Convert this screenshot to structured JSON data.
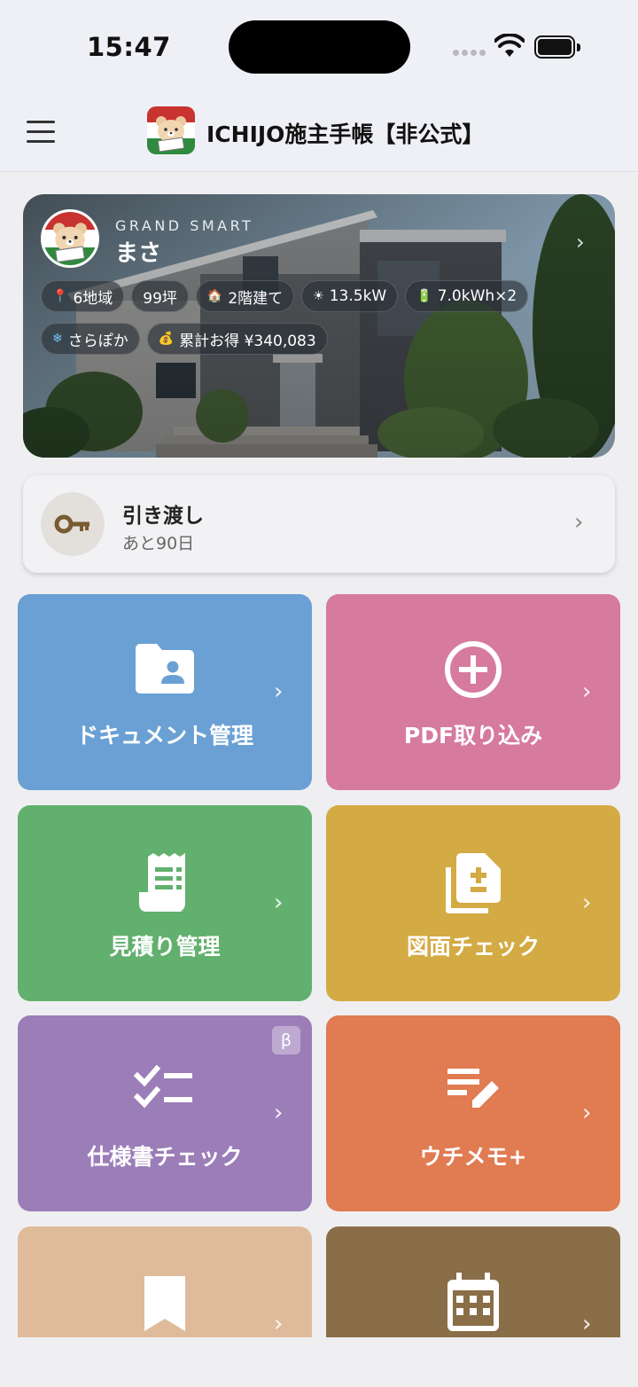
{
  "status_bar": {
    "time": "15:47"
  },
  "header": {
    "title": "ICHIJO施主手帳【非公式】"
  },
  "hero": {
    "model": "GRAND SMART",
    "owner": "まさ",
    "chips_row1": [
      {
        "icon": "📍",
        "label": "6地域"
      },
      {
        "icon": "",
        "label": "99坪"
      },
      {
        "icon": "🏠",
        "label": "2階建て"
      },
      {
        "icon": "☀",
        "label": "13.5kW"
      },
      {
        "icon": "🔋",
        "label": "7.0kWh×2"
      }
    ],
    "chips_row2": [
      {
        "icon": "❄",
        "label": "さらぽか"
      },
      {
        "icon": "💰",
        "label": "累計お得 ¥340,083"
      }
    ]
  },
  "handover": {
    "title": "引き渡し",
    "subtitle": "あと90日"
  },
  "tiles": [
    {
      "label": "ドキュメント管理",
      "color": "#6aa0d4",
      "icon": "folder-person-icon"
    },
    {
      "label": "PDF取り込み",
      "color": "#d67a9e",
      "icon": "add-circle-icon"
    },
    {
      "label": "見積り管理",
      "color": "#62b06e",
      "icon": "receipt-icon"
    },
    {
      "label": "図面チェック",
      "color": "#d4aa44",
      "icon": "document-add-icon"
    },
    {
      "label": "仕様書チェック",
      "color": "#9b7db8",
      "icon": "checklist-icon",
      "badge": "β"
    },
    {
      "label": "ウチメモ+",
      "color": "#e07b52",
      "icon": "note-edit-icon"
    },
    {
      "label": "",
      "color": "#dfbb9b",
      "icon": "bookmark-icon"
    },
    {
      "label": "",
      "color": "#8a6e47",
      "icon": "calendar-icon"
    }
  ]
}
